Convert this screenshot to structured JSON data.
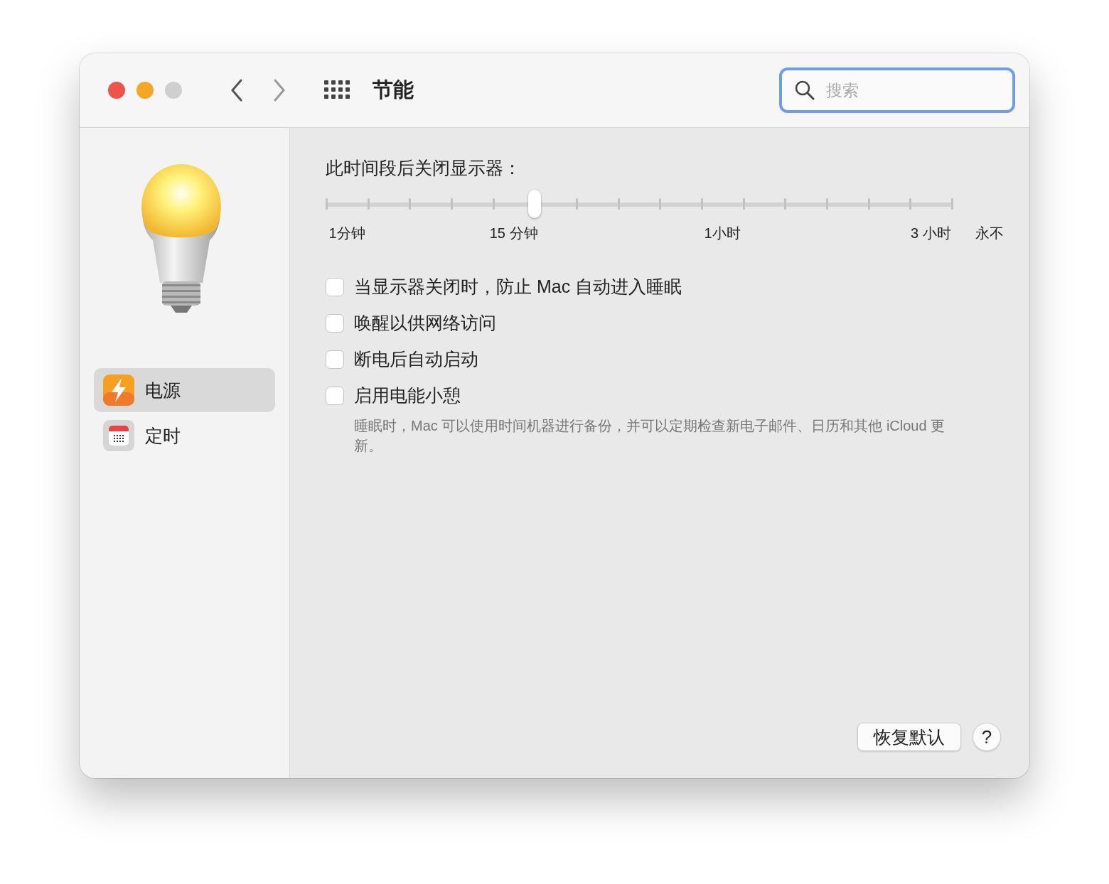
{
  "window": {
    "title": "节能"
  },
  "search": {
    "placeholder": "搜索"
  },
  "sidebar": {
    "items": [
      {
        "label": "电源",
        "kind": "power",
        "selected": true
      },
      {
        "label": "定时",
        "kind": "schedule",
        "selected": false
      }
    ]
  },
  "display_sleep": {
    "label": "此时间段后关闭显示器：",
    "level": 0.333,
    "tick_labels": [
      "1分钟",
      "15 分钟",
      "1小时",
      "3 小时",
      "永不"
    ]
  },
  "options": [
    {
      "label": "当显示器关闭时，防止 Mac 自动进入睡眠",
      "checked": false
    },
    {
      "label": "唤醒以供网络访问",
      "checked": false
    },
    {
      "label": "断电后自动启动",
      "checked": false
    },
    {
      "label": "启用电能小憩",
      "checked": false,
      "description": "睡眠时，Mac 可以使用时间机器进行备份，并可以定期检查新电子邮件、日历和其他 iCloud 更新。"
    }
  ],
  "buttons": {
    "restore": "恢复默认",
    "help": "?"
  }
}
